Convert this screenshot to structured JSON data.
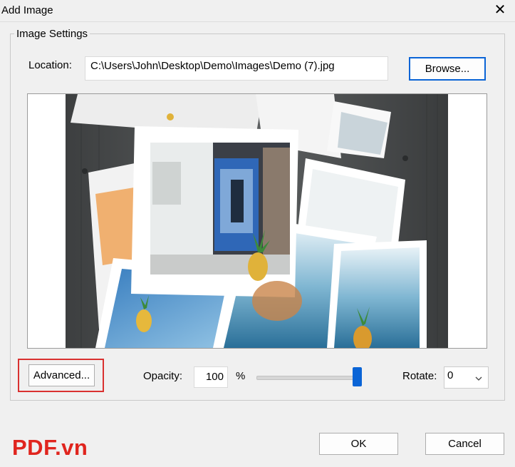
{
  "window": {
    "title": "Add Image",
    "close_symbol": "✕"
  },
  "group": {
    "label": "Image Settings"
  },
  "location": {
    "label": "Location:",
    "value": "C:\\Users\\John\\Desktop\\Demo\\Images\\Demo (7).jpg"
  },
  "browse_label": "Browse...",
  "advanced_label": "Advanced...",
  "opacity": {
    "label": "Opacity:",
    "value": "100",
    "unit": "%",
    "slider_fraction": 1.0
  },
  "rotate": {
    "label": "Rotate:",
    "value": "0"
  },
  "buttons": {
    "ok": "OK",
    "cancel": "Cancel"
  },
  "watermark": "PDF.vn",
  "colors": {
    "accent": "#0a64d6",
    "highlight": "#d9302f",
    "watermark": "#e0251e"
  }
}
